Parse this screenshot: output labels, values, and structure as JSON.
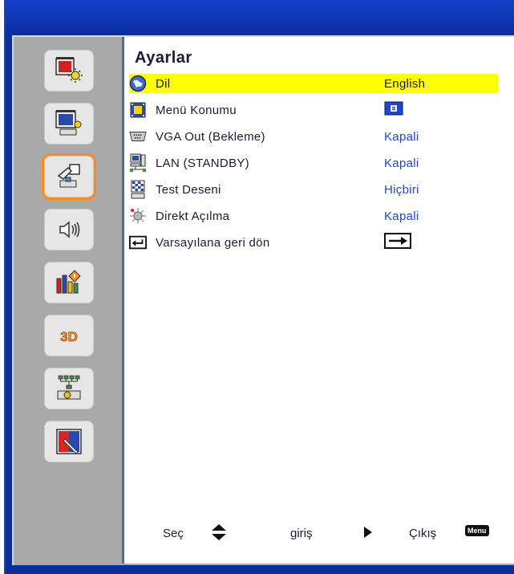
{
  "menu": {
    "title": "Ayarlar",
    "rows": [
      {
        "label": "Dil",
        "value": "English",
        "icon": "globe-icon",
        "selected": true
      },
      {
        "label": "Menü Konumu",
        "value": "",
        "icon": "menu-position-icon",
        "value_icon": "menu-center-icon"
      },
      {
        "label": "VGA Out (Bekleme)",
        "value": "Kapali",
        "icon": "vga-port-icon"
      },
      {
        "label": "LAN (STANDBY)",
        "value": "Kapali",
        "icon": "network-computer-icon"
      },
      {
        "label": "Test Deseni",
        "value": "Hiçbiri",
        "icon": "test-pattern-icon"
      },
      {
        "label": "Direkt Açılma",
        "value": "Kapali",
        "icon": "direct-power-icon"
      },
      {
        "label": "Varsayılana geri dön",
        "value": "",
        "icon": "return-icon",
        "value_icon": "right-arrow-box-icon"
      }
    ]
  },
  "sidebar": {
    "items": [
      {
        "name": "image-settings-icon"
      },
      {
        "name": "display-settings-icon"
      },
      {
        "name": "setup-icon",
        "active": true
      },
      {
        "name": "volume-icon"
      },
      {
        "name": "options-icon"
      },
      {
        "name": "3d-icon",
        "text": "3D"
      },
      {
        "name": "network-icon"
      },
      {
        "name": "pen-icon"
      }
    ]
  },
  "footer": {
    "select_label": "Seç",
    "enter_label": "giriş",
    "exit_label": "Çıkış",
    "menu_key": "Menu"
  },
  "colors": {
    "frame": "#0a2e9e",
    "selected_row": "#ffff00",
    "value_text": "#1e46d6",
    "active_outline": "#ff8a1a"
  }
}
